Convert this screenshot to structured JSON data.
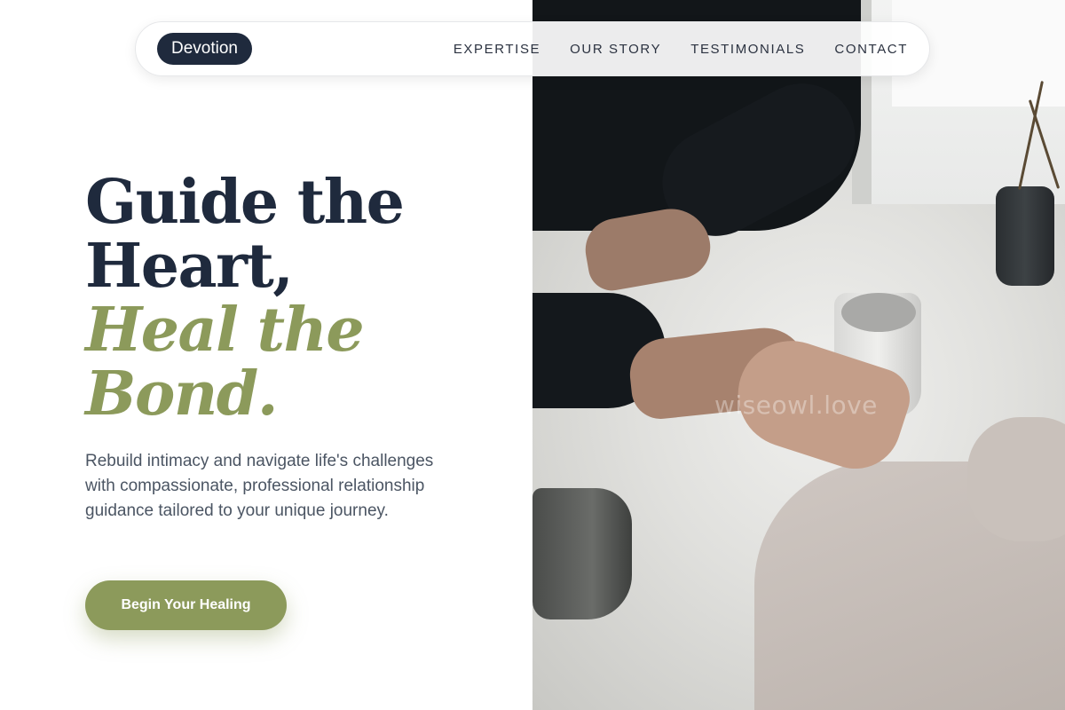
{
  "brand": {
    "logo_text": "Devotion"
  },
  "nav": {
    "links": [
      {
        "label": "EXPERTISE"
      },
      {
        "label": "OUR STORY"
      },
      {
        "label": "TESTIMONIALS"
      },
      {
        "label": "CONTACT"
      }
    ]
  },
  "hero": {
    "headline_line1": "Guide the",
    "headline_line2": "Heart,",
    "headline_line3": "Heal the",
    "headline_line4": "Bond.",
    "subtext": "Rebuild intimacy and navigate life's challenges with compassionate, professional relationship guidance tailored to your unique journey.",
    "cta_label": "Begin Your Healing"
  },
  "photo": {
    "watermark": "wiseowl.love"
  },
  "colors": {
    "navy": "#1f2a3d",
    "olive": "#8c9a5b",
    "body_text": "#4b5563"
  }
}
